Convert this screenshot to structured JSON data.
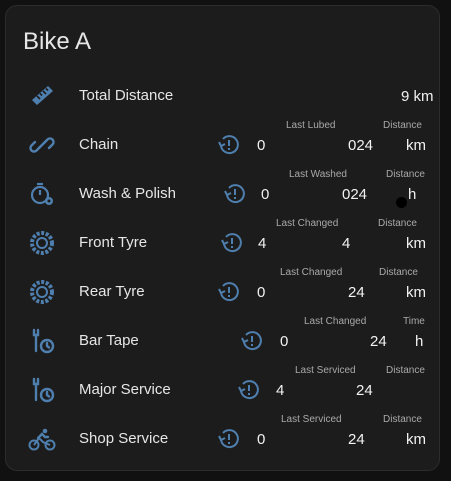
{
  "card": {
    "title": "Bike A"
  },
  "rows": [
    {
      "label": "Total Distance",
      "icon": "ruler-icon",
      "value": "9 km"
    },
    {
      "label": "Chain",
      "icon": "chain-link-icon",
      "col1_header": "Last Lubed",
      "col1_value": "0",
      "col1_suffix": "024",
      "col2_header": "Distance",
      "col2_value": "km"
    },
    {
      "label": "Wash & Polish",
      "icon": "stopwatch-gear-icon",
      "col1_header": "Last Washed",
      "col1_value": "0",
      "col1_suffix": "024",
      "col2_header": "Distance",
      "col2_value": "h"
    },
    {
      "label": "Front Tyre",
      "icon": "tyre-icon",
      "col1_header": "Last Changed",
      "col1_value": "4",
      "col1_suffix": "4",
      "col2_header": "Distance",
      "col2_value": "km"
    },
    {
      "label": "Rear Tyre",
      "icon": "tyre-icon",
      "col1_header": "Last Changed",
      "col1_value": "0",
      "col1_suffix": "24",
      "col2_header": "Distance",
      "col2_value": "km"
    },
    {
      "label": "Bar Tape",
      "icon": "wrench-clock-icon",
      "col1_header": "Last Changed",
      "col1_value": "0",
      "col1_suffix": "24",
      "col2_header": "Time",
      "col2_value": "h"
    },
    {
      "label": "Major Service",
      "icon": "wrench-clock-icon",
      "col1_header": "Last Serviced",
      "col1_value": "4",
      "col1_suffix": "24",
      "col2_header": "Distance",
      "col2_value": ""
    },
    {
      "label": "Shop Service",
      "icon": "cyclist-icon",
      "col1_header": "Last Serviced",
      "col1_value": "0",
      "col1_suffix": "24",
      "col2_header": "Distance",
      "col2_value": "km"
    }
  ],
  "colors": {
    "icon": "#4f7fae",
    "background": "#111111",
    "card": "#1c1c1c"
  }
}
